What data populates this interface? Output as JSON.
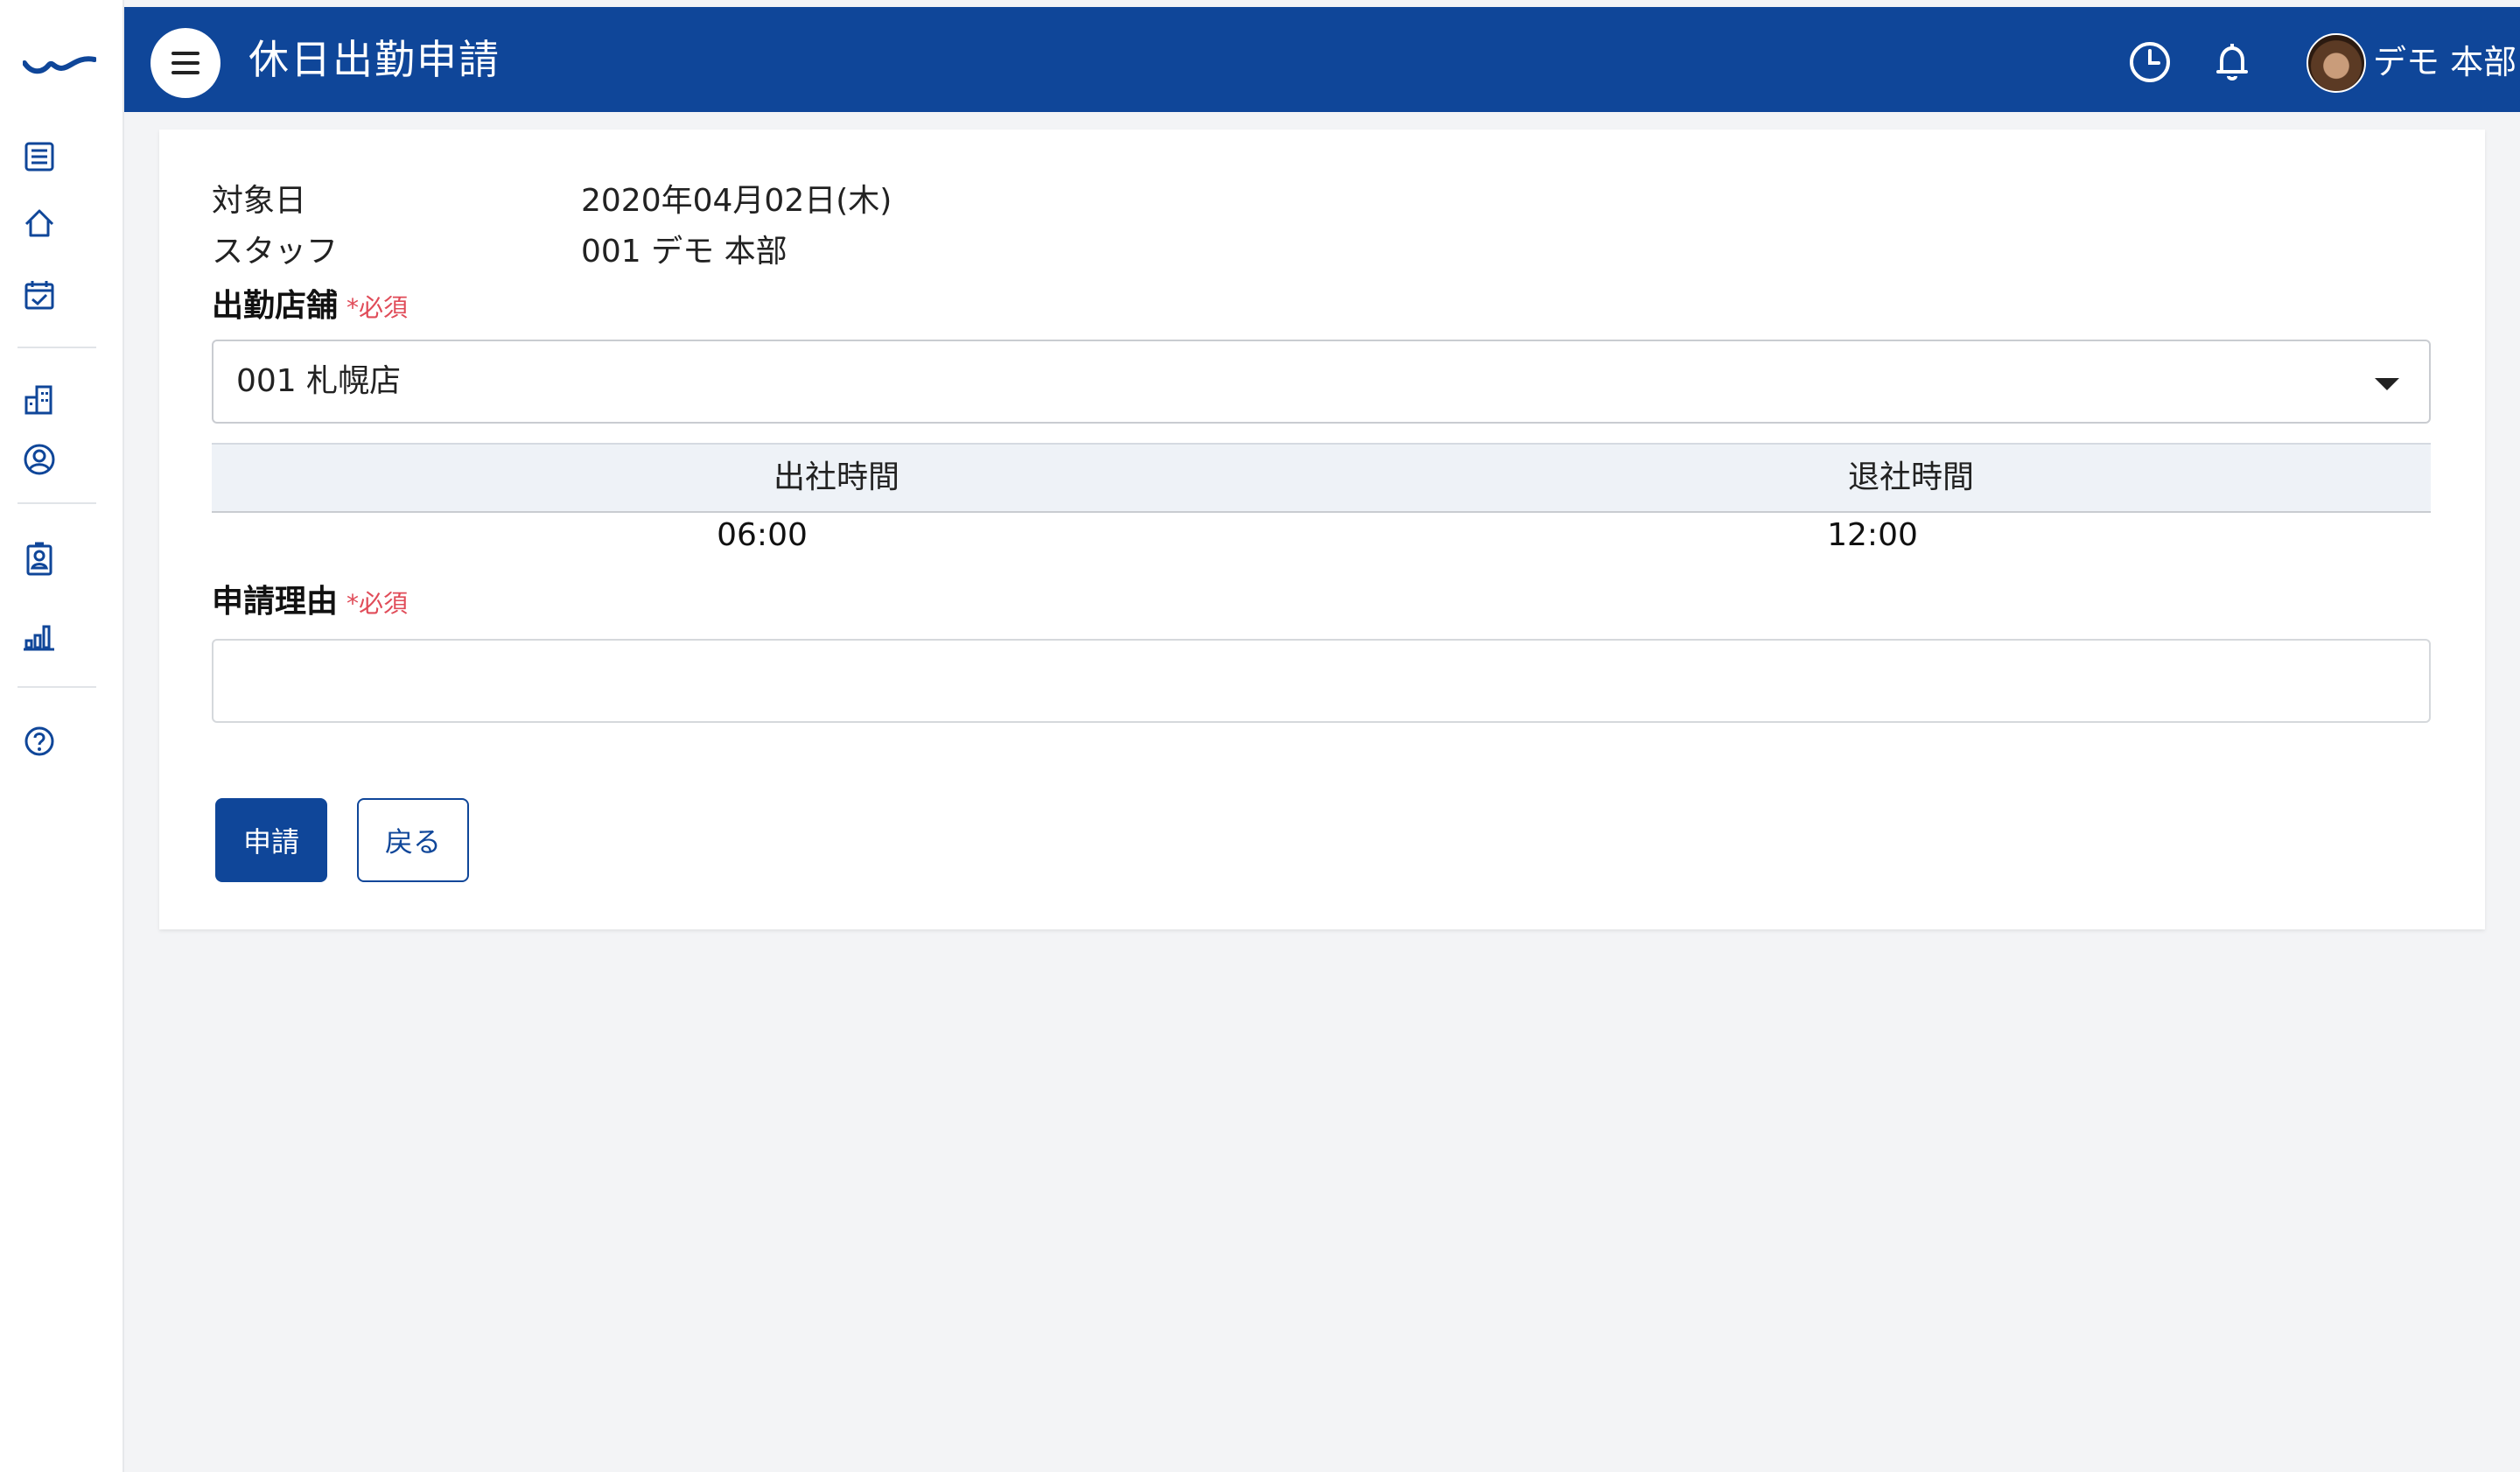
{
  "app": {
    "brand_color": "#0f4699",
    "accent_required_color": "#e04b58"
  },
  "header": {
    "title": "休日出勤申請",
    "icons": [
      "menu-icon",
      "clock-icon",
      "bell-icon"
    ],
    "user": {
      "name": "デモ 本部"
    }
  },
  "sidebar": {
    "items": [
      {
        "icon": "list-icon"
      },
      {
        "icon": "home-icon"
      },
      {
        "icon": "calendar-check-icon"
      },
      {
        "icon": "building-icon"
      },
      {
        "icon": "user-circle-icon"
      },
      {
        "icon": "id-card-icon"
      },
      {
        "icon": "bar-chart-icon"
      },
      {
        "icon": "help-icon"
      }
    ]
  },
  "form": {
    "target_date": {
      "label": "対象日",
      "value": "2020年04月02日(木)"
    },
    "staff": {
      "label": "スタッフ",
      "value": "001 デモ 本部"
    },
    "store": {
      "label": "出勤店舗",
      "required": "*必須",
      "value": "001 札幌店"
    },
    "times": {
      "headers": [
        "出社時間",
        "退社時間"
      ],
      "values": [
        "06:00",
        "12:00"
      ]
    },
    "reason": {
      "label": "申請理由",
      "required": "*必須",
      "value": ""
    },
    "buttons": {
      "submit": "申請",
      "back": "戻る"
    }
  }
}
